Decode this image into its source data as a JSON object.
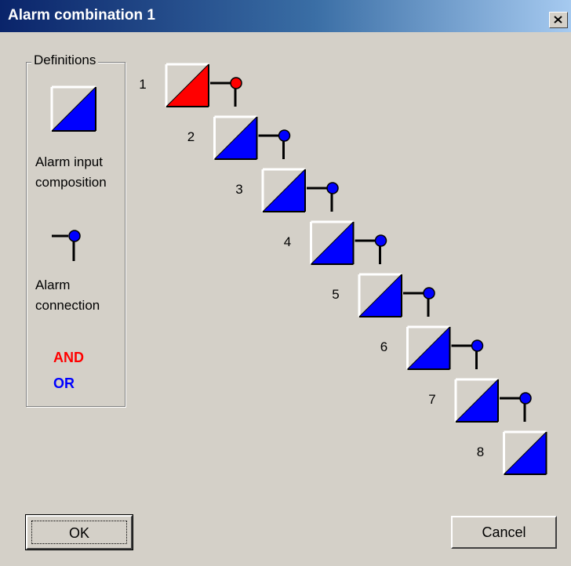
{
  "window": {
    "title": "Alarm combination 1",
    "close_glyph": "✕"
  },
  "definitions": {
    "group_label": "Definitions",
    "composition_label_line1": "Alarm input",
    "composition_label_line2": "composition",
    "connection_label_line1": "Alarm",
    "connection_label_line2": "connection",
    "and_label": "AND",
    "or_label": "OR",
    "and_color": "#ff0000",
    "or_color": "#0000ff"
  },
  "inputs": [
    {
      "number": "1",
      "mode": "AND"
    },
    {
      "number": "2",
      "mode": "OR"
    },
    {
      "number": "3",
      "mode": "OR"
    },
    {
      "number": "4",
      "mode": "OR"
    },
    {
      "number": "5",
      "mode": "OR"
    },
    {
      "number": "6",
      "mode": "OR"
    },
    {
      "number": "7",
      "mode": "OR"
    },
    {
      "number": "8",
      "mode": "OR"
    }
  ],
  "buttons": {
    "ok": "OK",
    "cancel": "Cancel"
  }
}
